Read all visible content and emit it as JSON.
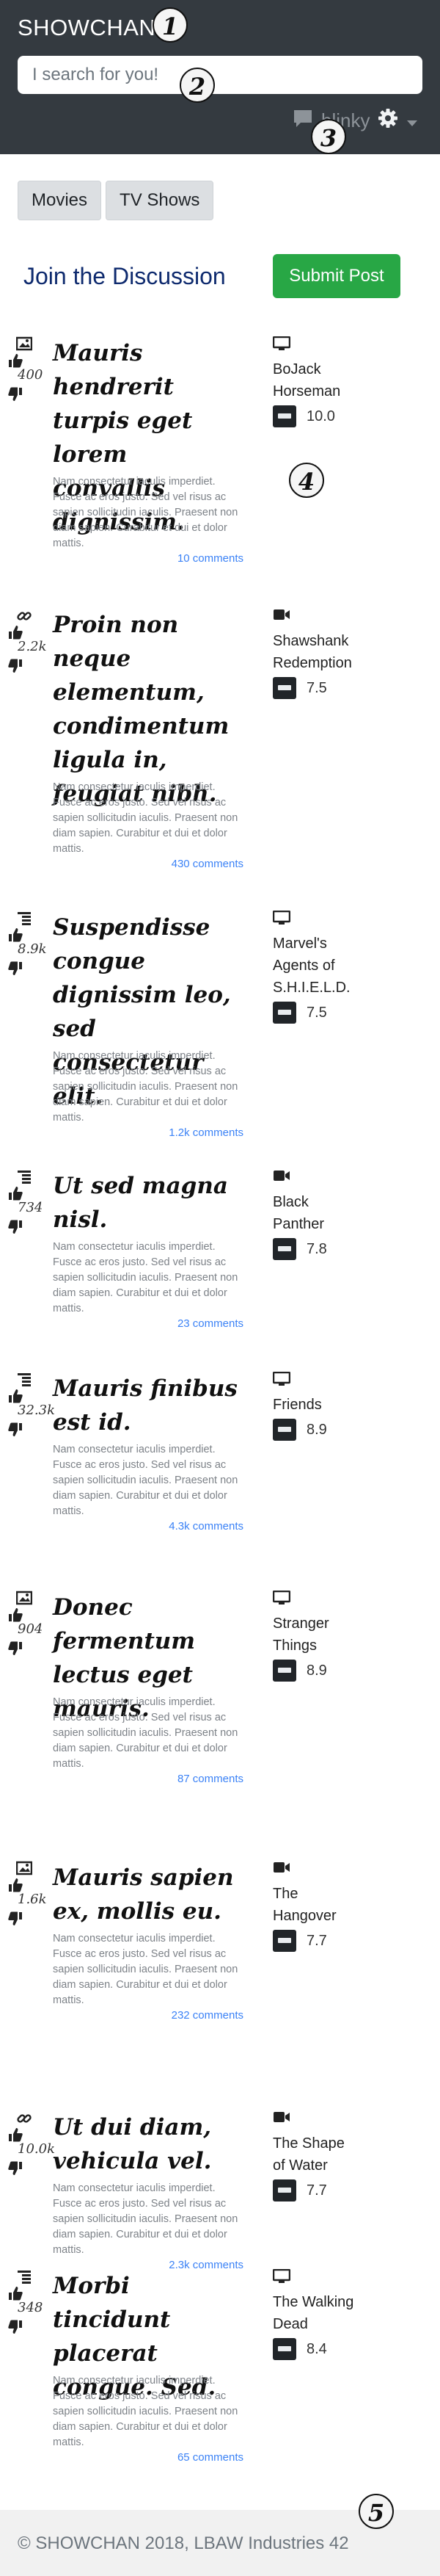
{
  "header": {
    "brand": "SHOWCHAN",
    "search_placeholder": "I search for you!",
    "username": "blinky",
    "markers": [
      "1",
      "2",
      "3"
    ]
  },
  "categories": [
    "Movies",
    "TV Shows"
  ],
  "join_text": "Join the Discussion",
  "submit_label": "Submit Post",
  "posts": [
    {
      "type_icon": "image-icon",
      "votes": "400",
      "title": "Mauris hendrerit turpis eget lorem convallis dignissim.",
      "body": "Nam consectetur iaculis imperdiet. Fusce ac eros justo. Sed vel risus ac sapien sollicitudin iaculis. Praesent non diam sapien. Curabitur et dui et dolor mattis.",
      "comments": "10 comments",
      "show": "BoJack Horseman",
      "show_icon": "tv-icon",
      "rating": "10.0"
    },
    {
      "type_icon": "link-icon",
      "votes": "2.2k",
      "title": "Proin non neque elementum, condimentum ligula in, feugiat nibh.",
      "body": "Nam consectetur iaculis imperdiet. Fusce ac eros justo. Sed vel risus ac sapien sollicitudin iaculis. Praesent non diam sapien. Curabitur et dui et dolor mattis.",
      "comments": "430 comments",
      "show": "Shawshank Redemption",
      "show_icon": "video-camera-icon",
      "rating": "7.5"
    },
    {
      "type_icon": "text-lines-icon",
      "votes": "8.9k",
      "title": "Suspendisse congue dignissim leo, sed consectetur elit.",
      "body": "Nam consectetur iaculis imperdiet. Fusce ac eros justo. Sed vel risus ac sapien sollicitudin iaculis. Praesent non diam sapien. Curabitur et dui et dolor mattis.",
      "comments": "1.2k comments",
      "show": "Marvel's Agents of S.H.I.E.L.D.",
      "show_icon": "tv-icon",
      "rating": "7.5"
    },
    {
      "type_icon": "text-lines-icon",
      "votes": "734",
      "title": "Ut sed magna nisl.",
      "body": "Nam consectetur iaculis imperdiet. Fusce ac eros justo. Sed vel risus ac sapien sollicitudin iaculis. Praesent non diam sapien. Curabitur et dui et dolor mattis.",
      "comments": "23 comments",
      "show": "Black Panther",
      "show_icon": "video-camera-icon",
      "rating": "7.8"
    },
    {
      "type_icon": "text-lines-icon",
      "votes": "32.3k",
      "title": "Mauris finibus est id.",
      "body": "Nam consectetur iaculis imperdiet. Fusce ac eros justo. Sed vel risus ac sapien sollicitudin iaculis. Praesent non diam sapien. Curabitur et dui et dolor mattis.",
      "comments": "4.3k comments",
      "show": "Friends",
      "show_icon": "tv-icon",
      "rating": "8.9"
    },
    {
      "type_icon": "image-icon",
      "votes": "904",
      "title": "Donec fermentum lectus eget mauris.",
      "body": "Nam consectetur iaculis imperdiet. Fusce ac eros justo. Sed vel risus ac sapien sollicitudin iaculis. Praesent non diam sapien. Curabitur et dui et dolor mattis.",
      "comments": "87 comments",
      "show": "Stranger Things",
      "show_icon": "tv-icon",
      "rating": "8.9"
    },
    {
      "type_icon": "image-icon",
      "votes": "1.6k",
      "title": "Mauris sapien ex, mollis eu.",
      "body": "Nam consectetur iaculis imperdiet. Fusce ac eros justo. Sed vel risus ac sapien sollicitudin iaculis. Praesent non diam sapien. Curabitur et dui et dolor mattis.",
      "comments": "232 comments",
      "show": "The Hangover",
      "show_icon": "video-camera-icon",
      "rating": "7.7"
    },
    {
      "type_icon": "link-icon",
      "votes": "10.0k",
      "title": "Ut dui diam, vehicula vel.",
      "body": "Nam consectetur iaculis imperdiet. Fusce ac eros justo. Sed vel risus ac sapien sollicitudin iaculis. Praesent non diam sapien. Curabitur et dui et dolor mattis.",
      "comments": "2.3k comments",
      "show": "The Shape of Water",
      "show_icon": "video-camera-icon",
      "rating": "7.7"
    },
    {
      "type_icon": "text-lines-icon",
      "votes": "348",
      "title": "Morbi tincidunt placerat congue. Sed.",
      "body": "Nam consectetur iaculis imperdiet. Fusce ac eros justo. Sed vel risus ac sapien sollicitudin iaculis. Praesent non diam sapien. Curabitur et dui et dolor mattis.",
      "comments": "65 comments",
      "show": "The Walking Dead",
      "show_icon": "tv-icon",
      "rating": "8.4"
    }
  ],
  "footer": {
    "text": "© SHOWCHAN 2018, LBAW Industries 42",
    "marker": "5"
  },
  "marker4": "4",
  "colors": {
    "navbar": "#343a40",
    "submit": "#28a745",
    "link": "#3b82f6",
    "join": "#0e2a6e"
  }
}
